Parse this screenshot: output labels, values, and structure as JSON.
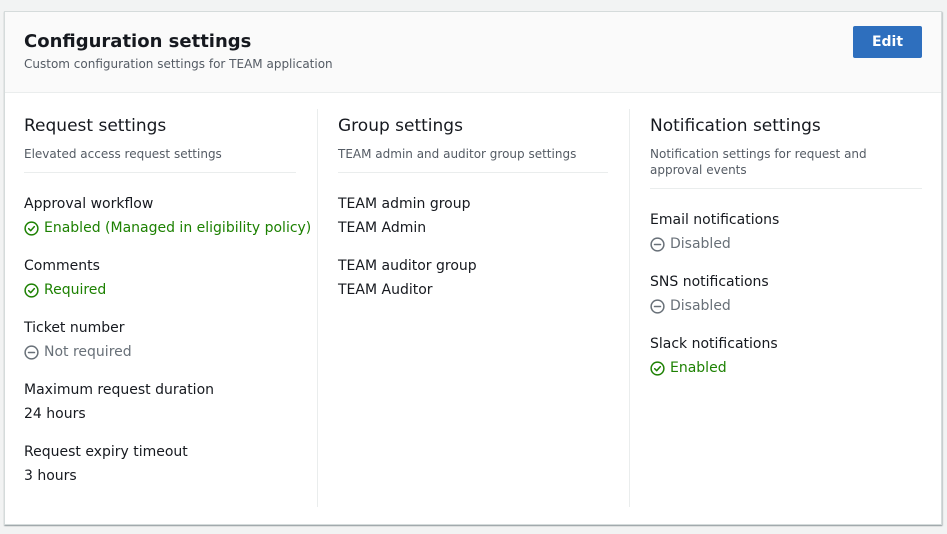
{
  "header": {
    "title": "Configuration settings",
    "description": "Custom configuration settings for TEAM application",
    "edit_label": "Edit"
  },
  "colors": {
    "primary_button": "#2e6fbe",
    "success": "#1d8102",
    "disabled": "#687078"
  },
  "request_settings": {
    "title": "Request settings",
    "description": "Elevated access request settings",
    "fields": [
      {
        "label": "Approval workflow",
        "value": "Enabled (Managed in eligibility policy)",
        "status": "success",
        "icon": "check-circle-icon"
      },
      {
        "label": "Comments",
        "value": "Required",
        "status": "success",
        "icon": "check-circle-icon"
      },
      {
        "label": "Ticket number",
        "value": "Not required",
        "status": "disabled",
        "icon": "minus-circle-icon"
      },
      {
        "label": "Maximum request duration",
        "value": "24 hours"
      },
      {
        "label": "Request expiry timeout",
        "value": "3 hours"
      }
    ]
  },
  "group_settings": {
    "title": "Group settings",
    "description": "TEAM admin and auditor group settings",
    "fields": [
      {
        "label": "TEAM admin group",
        "value": "TEAM Admin"
      },
      {
        "label": "TEAM auditor group",
        "value": "TEAM Auditor"
      }
    ]
  },
  "notification_settings": {
    "title": "Notification settings",
    "description": "Notification settings for request and approval events",
    "fields": [
      {
        "label": "Email notifications",
        "value": "Disabled",
        "status": "disabled",
        "icon": "minus-circle-icon"
      },
      {
        "label": "SNS notifications",
        "value": "Disabled",
        "status": "disabled",
        "icon": "minus-circle-icon"
      },
      {
        "label": "Slack notifications",
        "value": "Enabled",
        "status": "success",
        "icon": "check-circle-icon"
      }
    ]
  }
}
